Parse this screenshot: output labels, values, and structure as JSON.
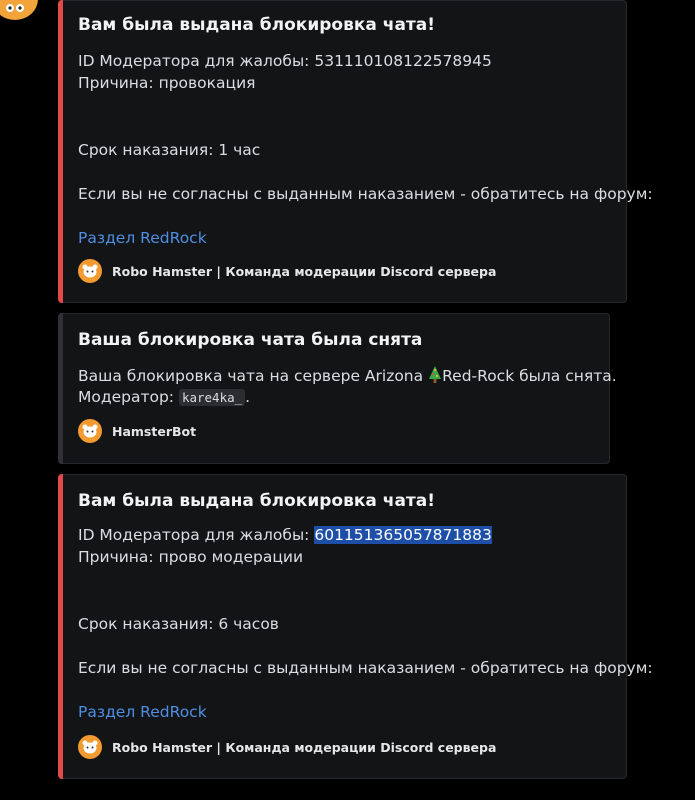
{
  "embeds": [
    {
      "title": "Вам была выдана блокировка чата!",
      "moderator_label": "ID Модератора для жалобы: ",
      "moderator_id": "531110108122578945",
      "reason": "Причина: провокация",
      "duration": "Срок наказания: 1 час",
      "appeal": "Если вы не согласны с выданным наказанием - обратитесь на форум:",
      "link": "Раздел RedRock",
      "footer": "Robo Hamster | Команда модерации Discord сервера",
      "accent": "#e24a4a"
    },
    {
      "title": "Ваша блокировка чата была снята",
      "text_before": "Ваша блокировка чата на сервере Arizona",
      "text_after": "Red-Rock была снята.",
      "moderator_label": "Модератор: ",
      "moderator": "kare4ka_",
      "period": ".",
      "footer": "HamsterBot",
      "accent": "#2f3136"
    },
    {
      "title": "Вам была выдана блокировка чата!",
      "moderator_label": "ID Модератора для жалобы: ",
      "moderator_id": "601151365057871883",
      "reason": "Причина: прово модерации",
      "duration": "Срок наказания: 6 часов",
      "appeal": "Если вы не согласны с выданным наказанием - обратитесь на форум:",
      "link": "Раздел RedRock",
      "footer": "Robo Hamster | Команда модерации Discord сервера",
      "accent": "#e24a4a"
    }
  ],
  "icons": {
    "top_avatar": "hamster-avatar-icon",
    "footer_icon": "hamster-icon",
    "tree": "christmas-tree-emoji"
  }
}
